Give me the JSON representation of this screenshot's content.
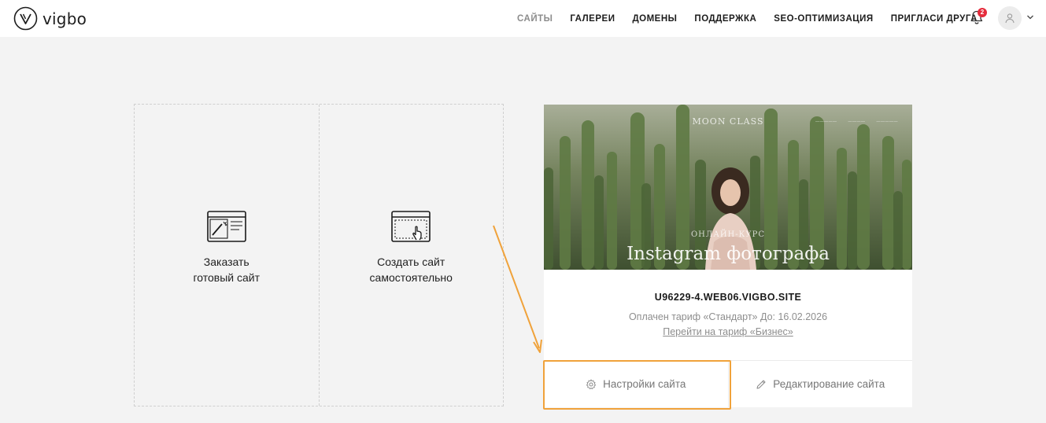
{
  "header": {
    "logo_text": "vigbo",
    "nav": [
      {
        "label": "САЙТЫ",
        "active": true
      },
      {
        "label": "ГАЛЕРЕИ",
        "active": false
      },
      {
        "label": "ДОМЕНЫ",
        "active": false
      },
      {
        "label": "ПОДДЕРЖКА",
        "active": false
      },
      {
        "label": "SEO-ОПТИМИЗАЦИЯ",
        "active": false
      },
      {
        "label": "ПРИГЛАСИ ДРУГА",
        "active": false
      }
    ],
    "notification_count": "2",
    "icons": {
      "bell": "bell-icon",
      "avatar": "user-icon",
      "chevron": "chevron-down-icon"
    }
  },
  "create": {
    "order_label": "Заказать\nготовый сайт",
    "self_label": "Создать сайт\nсамостоятельно"
  },
  "site": {
    "preview": {
      "brand": "MOON CLASS",
      "subtitle": "ОНЛАЙН-КУРС",
      "title": "Instagram фотографа"
    },
    "domain": "U96229-4.WEB06.VIGBO.SITE",
    "tariff": "Оплачен тариф «Стандарт» До: 16.02.2026",
    "upgrade": "Перейти на тариф «Бизнес»",
    "settings_label": "Настройки сайта",
    "edit_label": "Редактирование сайта"
  },
  "colors": {
    "accent_annotation": "#f0a23a",
    "badge": "#e52c3c",
    "nav_active": "#8c8c8c",
    "page_bg": "#f3f3f3"
  }
}
